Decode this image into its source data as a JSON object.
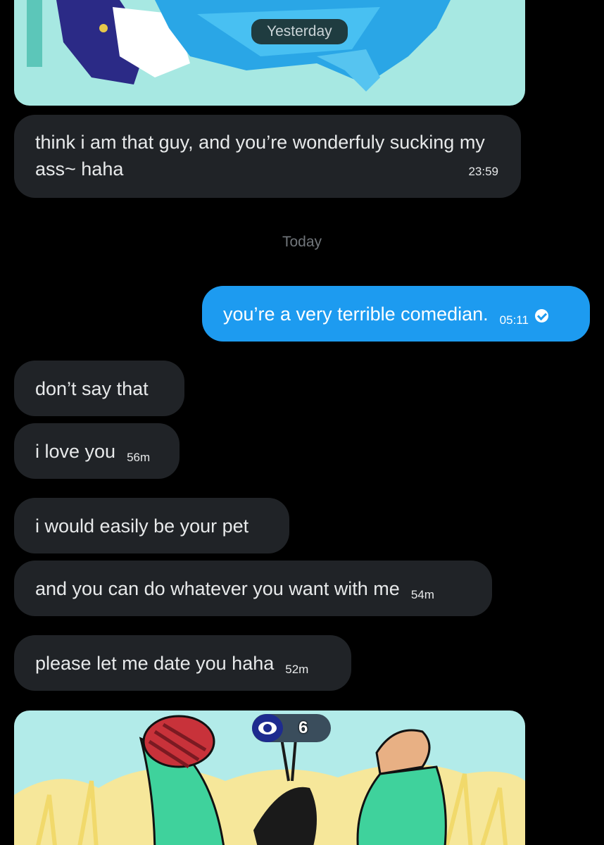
{
  "chat": {
    "day_separators": {
      "yesterday": "Yesterday",
      "today": "Today"
    },
    "messages": [
      {
        "text": "think i am that guy, and you’re wonderfuly sucking my ass~ haha",
        "time": "23:59",
        "direction": "received"
      },
      {
        "text": "you’re a very terrible comedian.",
        "time": "05:11",
        "direction": "sent",
        "status": "read"
      },
      {
        "text": "don’t say that",
        "time": "",
        "direction": "received"
      },
      {
        "text": "i love you",
        "time": "56m",
        "direction": "received"
      },
      {
        "text": "i would easily be your pet",
        "time": "",
        "direction": "received"
      },
      {
        "text": "and you can do whatever you want with me",
        "time": "54m",
        "direction": "received"
      },
      {
        "text": "please let me date you haha",
        "time": "52m",
        "direction": "received"
      }
    ],
    "media_bottom": {
      "view_count": "6",
      "icon": "view-once-eye-icon"
    }
  },
  "colors": {
    "background": "#000000",
    "received_bubble": "#202327",
    "sent_bubble": "#1d9bf0",
    "muted_text": "#71767b"
  }
}
